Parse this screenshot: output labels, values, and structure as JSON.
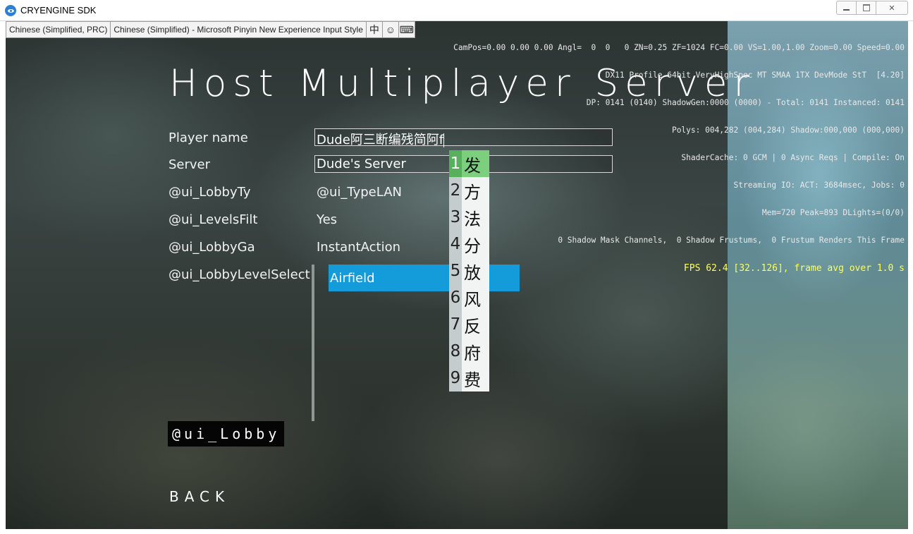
{
  "window": {
    "title": "CRYENGINE SDK",
    "buttons": [
      "minimize",
      "maximize",
      "close"
    ]
  },
  "ime_bar": {
    "language": "Chinese (Simplified, PRC)",
    "input_method": "Chinese (Simplified) - Microsoft Pinyin New Experience Input Style",
    "mode_glyph": "中",
    "extra_glyph": "☺",
    "extra_glyph2": "⌨"
  },
  "debug": {
    "line1": "CamPos=0.00 0.00 0.00 Angl=  0  0   0 ZN=0.25 ZF=1024 FC=0.00 VS=1.00,1.00 Zoom=0.00 Speed=0.00",
    "line2": "DX11 Profile 64bit VeryHighSpec MT SMAA 1TX DevMode StT  [4.20]",
    "line3": "DP: 0141 (0140) ShadowGen:0000 (0000) - Total: 0141 Instanced: 0141",
    "line4": "Polys: 004,282 (004,284) Shadow:000,000 (000,000)",
    "line5": "ShaderCache: 0 GCM | 0 Async Reqs | Compile: On",
    "line6": "Streaming IO: ACT: 3684msec, Jobs: 0",
    "line7": "Mem=720 Peak=893 DLights=(0/0)",
    "line8": "0 Shadow Mask Channels,  0 Shadow Frustums,  0 Frustum Renders This Frame",
    "fps": "FPS 62.4 [32..126], frame avg over 1.0 s"
  },
  "menu": {
    "title": "Host Multiplayer Server",
    "fields": {
      "player_name_label": "Player name",
      "player_name_value": "Dude阿三断编残简阿f",
      "server_label": "Server",
      "server_value": "Dude's Server",
      "lobby_type_label": "@ui_LobbyTy",
      "lobby_type_value": "@ui_TypeLAN",
      "levels_filter_label": "@ui_LevelsFilt",
      "levels_filter_value": "Yes",
      "lobby_game_label": "@ui_LobbyGa",
      "lobby_game_value": "InstantAction",
      "level_select_label": "@ui_LobbyLevelSelect"
    },
    "levels": [
      "Airfield"
    ],
    "selected_level": "Airfield",
    "lobby_button": "@ui_Lobby",
    "back_button": "BACK"
  },
  "ime_candidates": {
    "selected_index": 1,
    "items": [
      {
        "num": "1",
        "char": "发"
      },
      {
        "num": "2",
        "char": "方"
      },
      {
        "num": "3",
        "char": "法"
      },
      {
        "num": "4",
        "char": "分"
      },
      {
        "num": "5",
        "char": "放"
      },
      {
        "num": "6",
        "char": "风"
      },
      {
        "num": "7",
        "char": "反"
      },
      {
        "num": "8",
        "char": "府"
      },
      {
        "num": "9",
        "char": "费"
      }
    ]
  },
  "colors": {
    "selection_blue": "#149bd9",
    "candidate_green": "#7bcf7d",
    "fps_yellow": "#ffff55"
  }
}
